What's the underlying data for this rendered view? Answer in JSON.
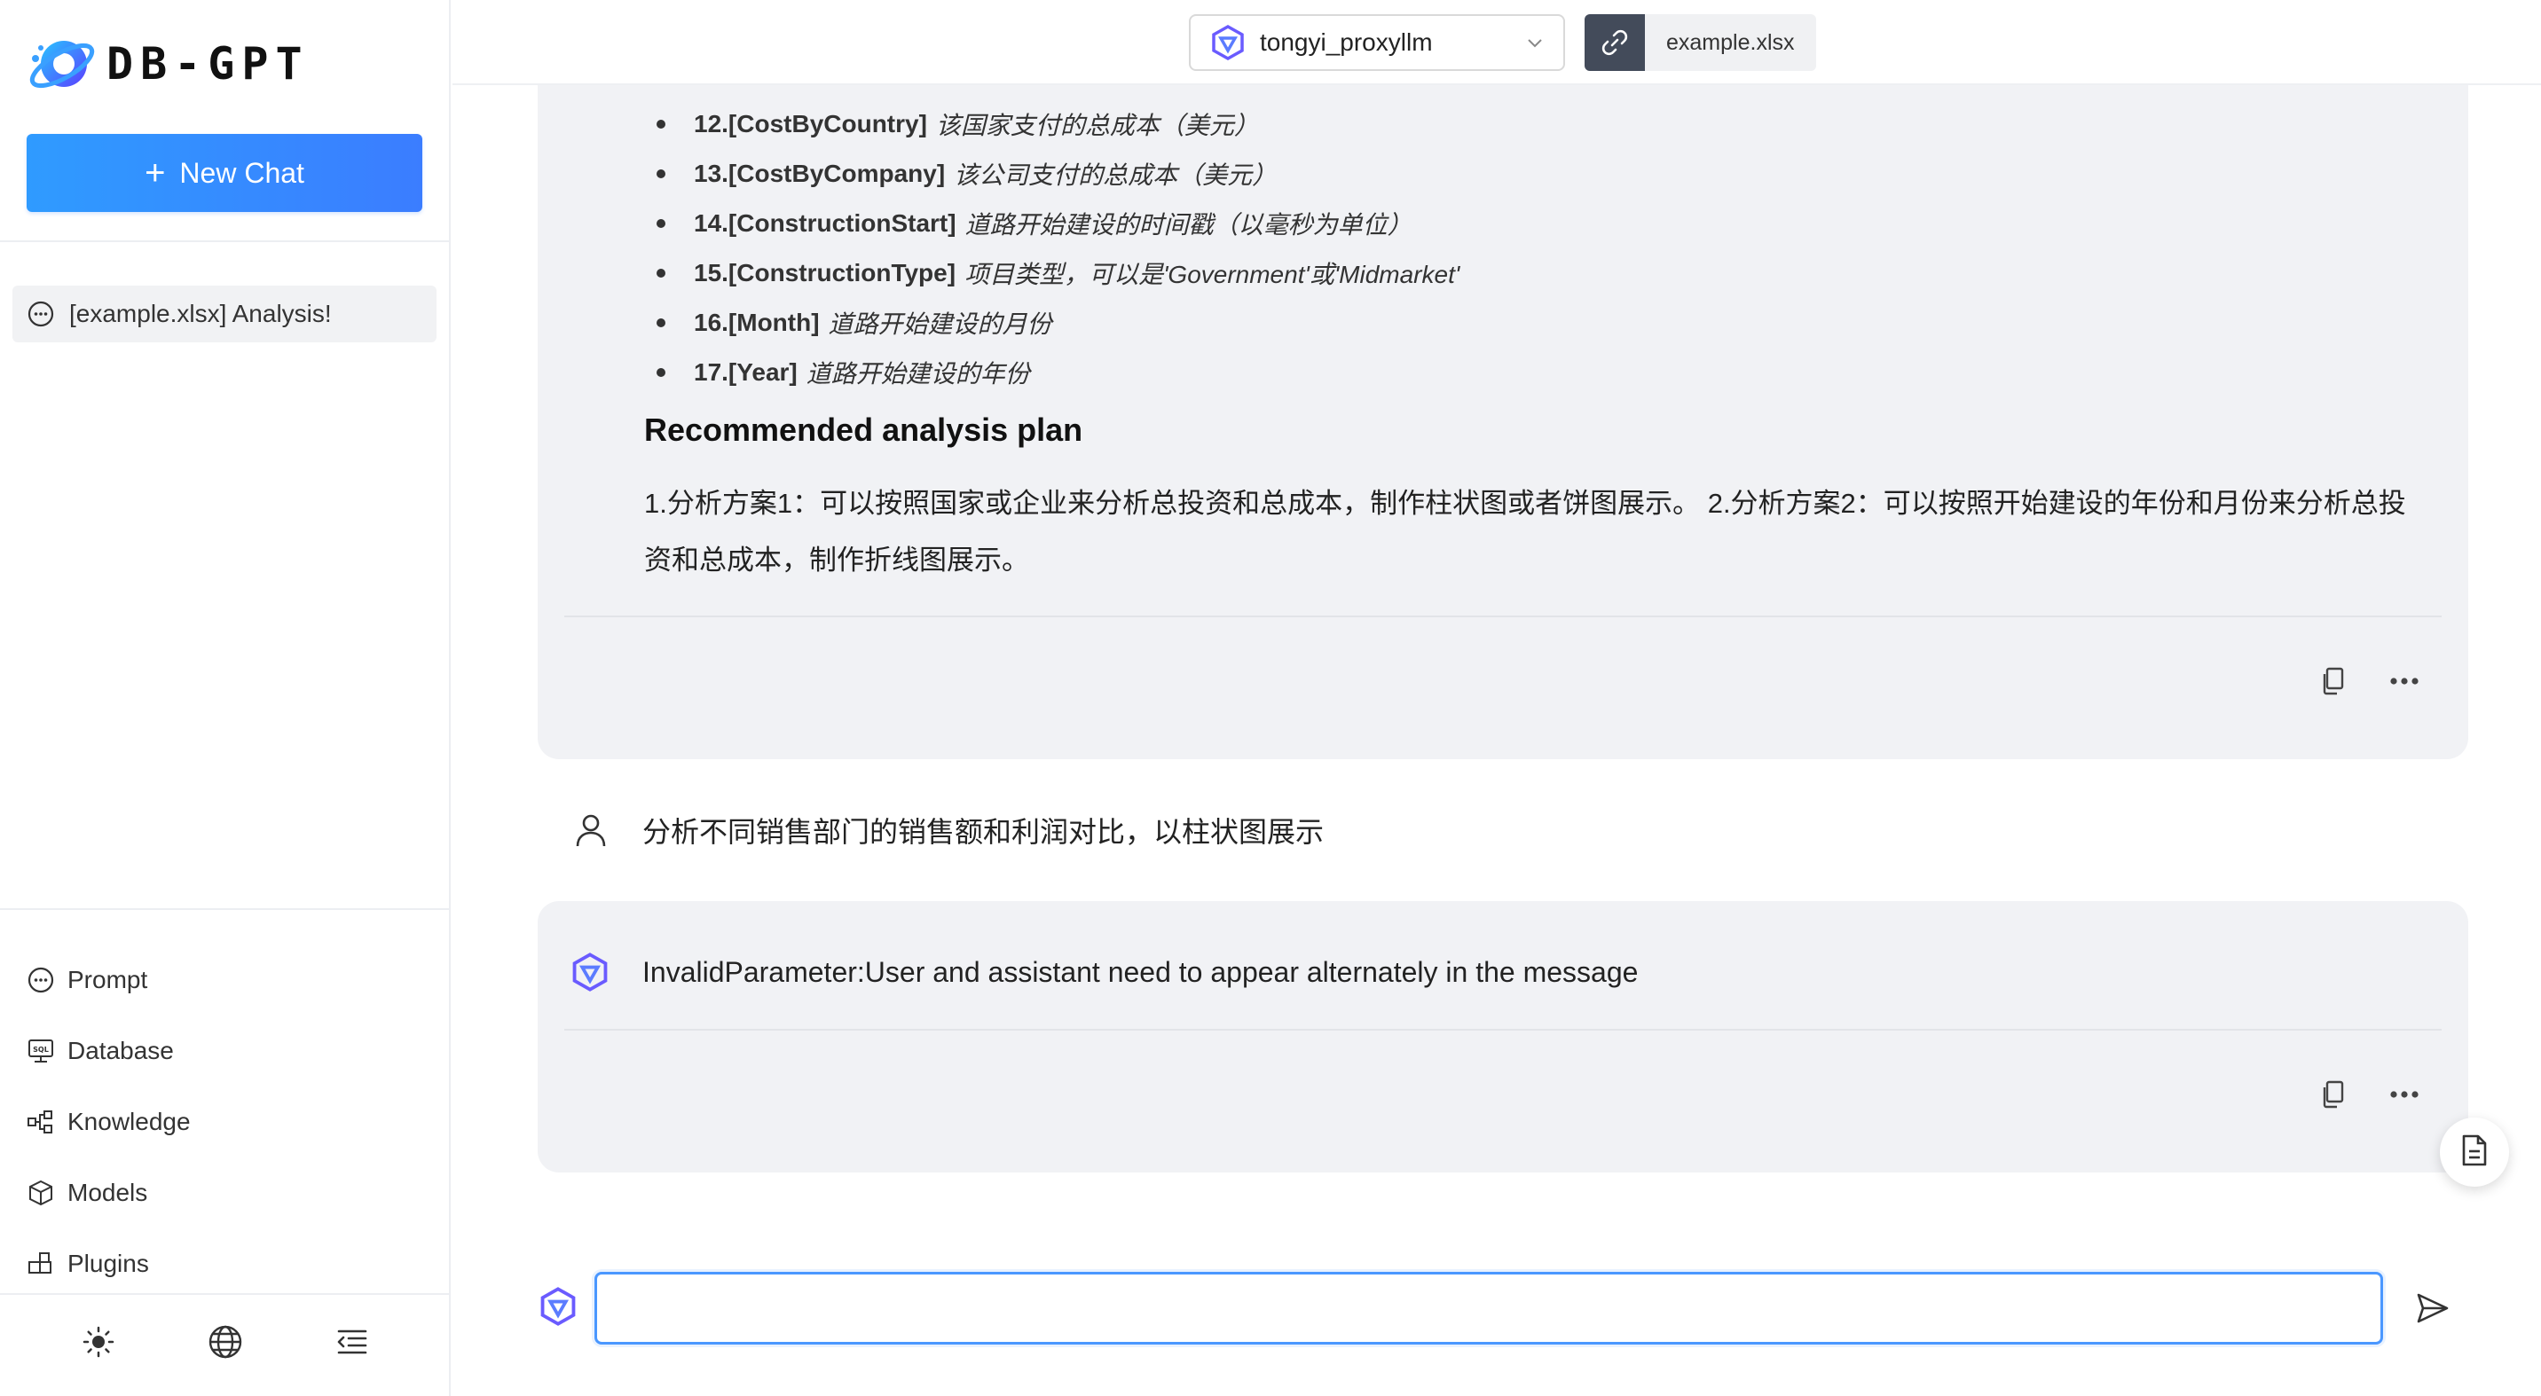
{
  "app": {
    "logo_text": "DB-GPT"
  },
  "sidebar": {
    "new_chat_label": "New Chat",
    "conversations": [
      {
        "label": "[example.xlsx] Analysis!"
      }
    ],
    "menu": [
      {
        "label": "Prompt",
        "icon": "chat-bubble-icon"
      },
      {
        "label": "Database",
        "icon": "sql-database-icon"
      },
      {
        "label": "Knowledge",
        "icon": "knowledge-graph-icon"
      },
      {
        "label": "Models",
        "icon": "cube-icon"
      },
      {
        "label": "Plugins",
        "icon": "plugins-icon"
      }
    ],
    "footer": [
      "theme-sun-icon",
      "language-globe-icon",
      "collapse-menu-icon"
    ]
  },
  "topbar": {
    "model": "tongyi_proxyllm",
    "file_name": "example.xlsx"
  },
  "messages": {
    "first_reply": {
      "columns": [
        {
          "key": "12.[CostByCountry]",
          "desc": "该国家支付的总成本（美元）"
        },
        {
          "key": "13.[CostByCompany]",
          "desc": "该公司支付的总成本（美元）"
        },
        {
          "key": "14.[ConstructionStart]",
          "desc": "道路开始建设的时间戳（以毫秒为单位）"
        },
        {
          "key": "15.[ConstructionType]",
          "desc": "项目类型，可以是'Government'或'Midmarket'"
        },
        {
          "key": "16.[Month]",
          "desc": "道路开始建设的月份"
        },
        {
          "key": "17.[Year]",
          "desc": "道路开始建设的年份"
        }
      ],
      "section_title": "Recommended analysis plan",
      "plan_text": "1.分析方案1：可以按照国家或企业来分析总投资和总成本，制作柱状图或者饼图展示。 2.分析方案2：可以按照开始建设的年份和月份来分析总投资和总成本，制作折线图展示。"
    },
    "user_message": "分析不同销售部门的销售额和利润对比，以柱状图展示",
    "error_reply": "InvalidParameter:User and assistant need to appear alternately in the message"
  },
  "input": {
    "placeholder": ""
  },
  "colors": {
    "accent": "#3b7dff",
    "bubble_bg": "#f1f2f5",
    "input_border": "#4a97ff"
  }
}
